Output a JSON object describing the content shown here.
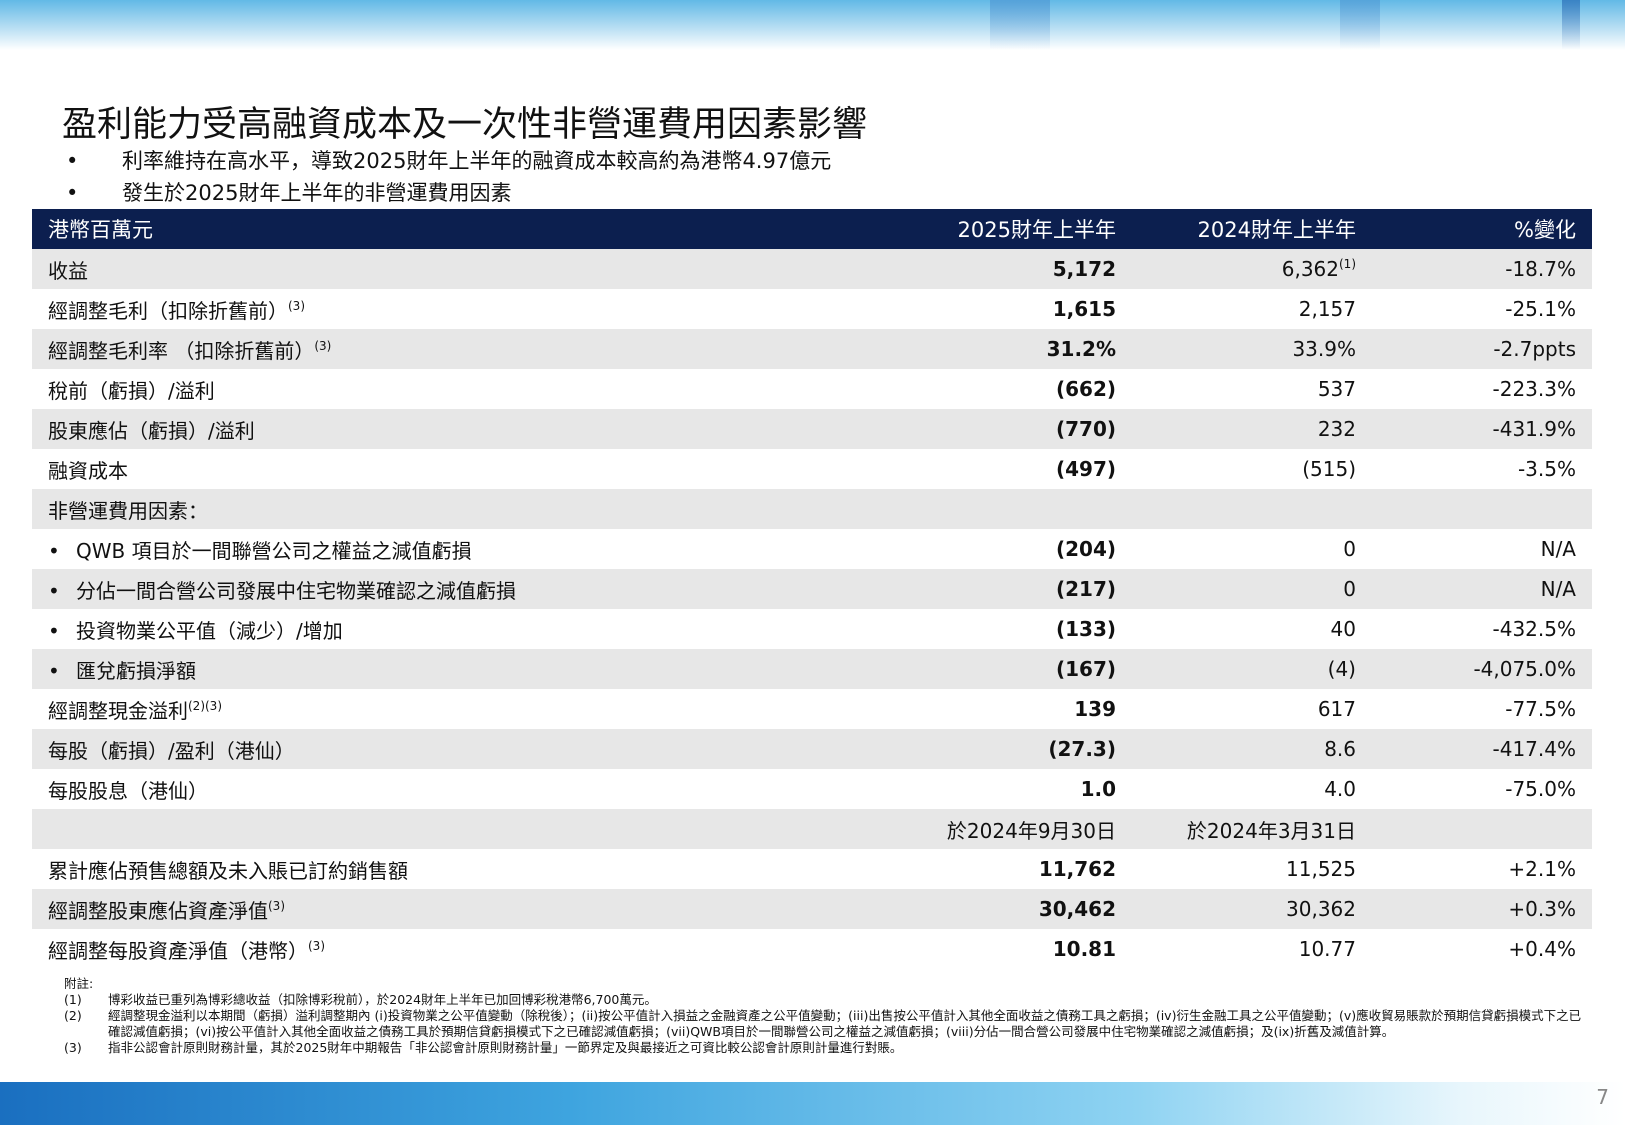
{
  "title": "盈利能力受高融資成本及一次性非營運費用因素影響",
  "bullets": [
    "利率維持在高水平，導致2025財年上半年的融資成本較高約為港幣4.97億元",
    "發生於2025財年上半年的非營運費用因素"
  ],
  "table": {
    "header": {
      "label": "港幣百萬元",
      "col_a": "2025財年上半年",
      "col_b": "2024財年上半年",
      "col_c": "%變化"
    },
    "rows": [
      {
        "label": "收益",
        "sup": "",
        "a": "5,172",
        "b": "6,362",
        "b_sup": "(1)",
        "c": "-18.7%"
      },
      {
        "label": "經調整毛利（扣除折舊前）",
        "sup": "(3)",
        "a": "1,615",
        "b": "2,157",
        "b_sup": "",
        "c": "-25.1%"
      },
      {
        "label": "經調整毛利率 （扣除折舊前）",
        "sup": "(3)",
        "a": "31.2%",
        "b": "33.9%",
        "b_sup": "",
        "c": "-2.7ppts"
      },
      {
        "label": "稅前（虧損）/溢利",
        "sup": "",
        "a": "(662)",
        "b": "537",
        "b_sup": "",
        "c": "-223.3%"
      },
      {
        "label": "股東應佔（虧損）/溢利",
        "sup": "",
        "a": "(770)",
        "b": "232",
        "b_sup": "",
        "c": "-431.9%"
      },
      {
        "label": "融資成本",
        "sup": "",
        "a": "(497)",
        "b": "(515)",
        "b_sup": "",
        "c": "-3.5%"
      },
      {
        "label": "非營運費用因素：",
        "sup": "",
        "a": "",
        "b": "",
        "b_sup": "",
        "c": ""
      },
      {
        "label": "QWB 項目於一間聯營公司之權益之減值虧損",
        "sup": "",
        "a": "(204)",
        "b": "0",
        "b_sup": "",
        "c": "N/A"
      },
      {
        "label": "分佔一間合營公司發展中住宅物業確認之減值虧損",
        "sup": "",
        "a": "(217)",
        "b": "0",
        "b_sup": "",
        "c": "N/A"
      },
      {
        "label": "投資物業公平值（減少）/增加",
        "sup": "",
        "a": "(133)",
        "b": "40",
        "b_sup": "",
        "c": "-432.5%"
      },
      {
        "label": "匯兌虧損淨額",
        "sup": "",
        "a": "(167)",
        "b": "(4)",
        "b_sup": "",
        "c": "-4,075.0%"
      },
      {
        "label": "經調整現金溢利",
        "sup": "(2)(3)",
        "a": "139",
        "b": "617",
        "b_sup": "",
        "c": "-77.5%"
      },
      {
        "label": "每股（虧損）/盈利（港仙）",
        "sup": "",
        "a": "(27.3)",
        "b": "8.6",
        "b_sup": "",
        "c": "-417.4%"
      },
      {
        "label": "每股股息（港仙）",
        "sup": "",
        "a": "1.0",
        "b": "4.0",
        "b_sup": "",
        "c": "-75.0%"
      },
      {
        "label": "",
        "sup": "",
        "a": "於2024年9月30日",
        "b": "於2024年3月31日",
        "b_sup": "",
        "c": ""
      },
      {
        "label": "累計應佔預售總額及未入賬已訂約銷售額",
        "sup": "",
        "a": "11,762",
        "b": "11,525",
        "b_sup": "",
        "c": "+2.1%"
      },
      {
        "label": "經調整股東應佔資產淨值",
        "sup": "(3)",
        "a": "30,462",
        "b": "30,362",
        "b_sup": "",
        "c": "+0.3%"
      },
      {
        "label": "經調整每股資產淨值（港幣）",
        "sup": "(3)",
        "a": "10.81",
        "b": "10.77",
        "b_sup": "",
        "c": "+0.4%"
      }
    ]
  },
  "footnotes": {
    "title": "附註:",
    "items": [
      {
        "num": "(1)",
        "text": "博彩收益已重列為博彩總收益（扣除博彩稅前），於2024財年上半年已加回博彩稅港幣6,700萬元。"
      },
      {
        "num": "(2)",
        "text": "經調整現金溢利以本期間（虧損）溢利調整期內 (i)投資物業之公平值變動（除稅後）；(ii)按公平值計入損益之金融資產之公平值變動；(iii)出售按公平值計入其他全面收益之債務工具之虧損；(iv)衍生金融工具之公平值變動；(v)應收貿易賬款於預期信貸虧損模式下之已確認減值虧損；(vi)按公平值計入其他全面收益之債務工具於預期信貸虧損模式下之已確認減值虧損；(vii)QWB項目於一間聯營公司之權益之減值虧損；(viii)分佔一間合營公司發展中住宅物業確認之減值虧損；及(ix)折舊及減值計算。"
      },
      {
        "num": "(3)",
        "text": "指非公認會計原則財務計量，其於2025財年中期報告「非公認會計原則財務計量」一節界定及與最接近之可資比較公認會計原則計量進行對賬。"
      }
    ]
  },
  "page_number": "7"
}
